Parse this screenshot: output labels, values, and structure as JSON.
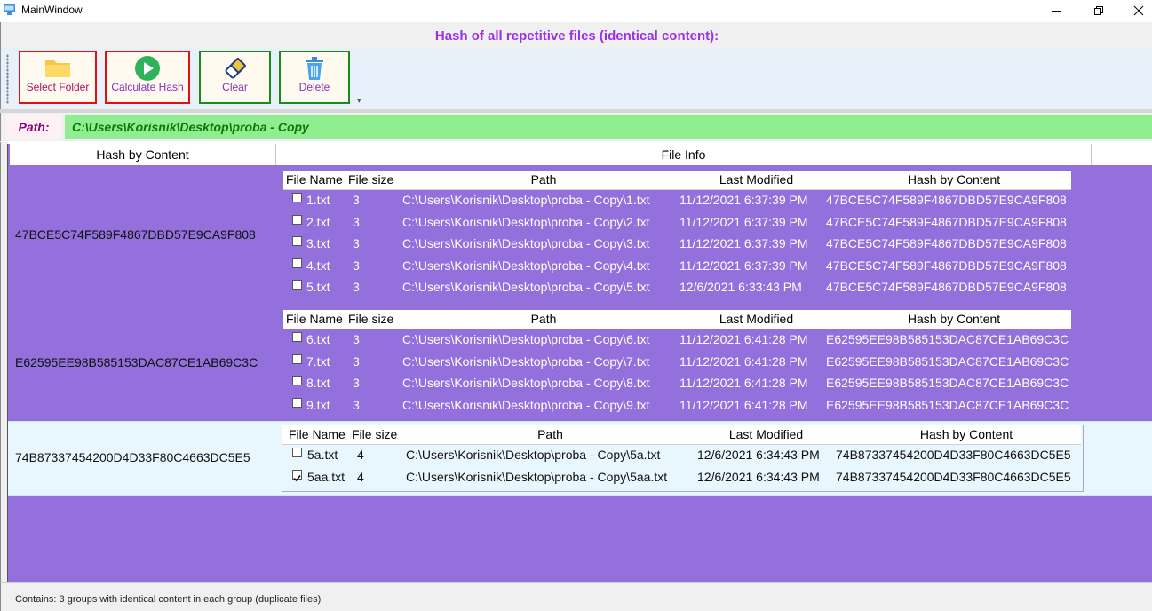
{
  "window": {
    "title": "MainWindow",
    "controls": {
      "minimize": "minimize-icon",
      "maximize": "restore-icon",
      "close": "close-icon"
    }
  },
  "header": {
    "title": "Hash of all repetitive files (identical content):",
    "color": "#9b30e8"
  },
  "toolbar": {
    "buttons": [
      {
        "label": "Select Folder",
        "icon": "folder-icon"
      },
      {
        "label": "Calculate Hash",
        "icon": "play-icon"
      },
      {
        "label": "Clear",
        "icon": "eraser-icon"
      },
      {
        "label": "Delete",
        "icon": "trash-icon"
      }
    ]
  },
  "path": {
    "label": "Path:",
    "value": "C:\\Users\\Korisnik\\Desktop\\proba - Copy"
  },
  "grid": {
    "columns": [
      "Hash by Content",
      "File Info"
    ],
    "inner_columns": [
      "File Name",
      "File size",
      "Path",
      "Last Modified",
      "Hash by Content"
    ],
    "groups": [
      {
        "hash": "47BCE5C74F589F4867DBD57E9CA9F808",
        "files": [
          {
            "name": "1.txt",
            "size": "3",
            "path": "C:\\Users\\Korisnik\\Desktop\\proba - Copy\\1.txt",
            "modified": "11/12/2021 6:37:39 PM",
            "hash": "47BCE5C74F589F4867DBD57E9CA9F808",
            "checked": false
          },
          {
            "name": "2.txt",
            "size": "3",
            "path": "C:\\Users\\Korisnik\\Desktop\\proba - Copy\\2.txt",
            "modified": "11/12/2021 6:37:39 PM",
            "hash": "47BCE5C74F589F4867DBD57E9CA9F808",
            "checked": false
          },
          {
            "name": "3.txt",
            "size": "3",
            "path": "C:\\Users\\Korisnik\\Desktop\\proba - Copy\\3.txt",
            "modified": "11/12/2021 6:37:39 PM",
            "hash": "47BCE5C74F589F4867DBD57E9CA9F808",
            "checked": false
          },
          {
            "name": "4.txt",
            "size": "3",
            "path": "C:\\Users\\Korisnik\\Desktop\\proba - Copy\\4.txt",
            "modified": "11/12/2021 6:37:39 PM",
            "hash": "47BCE5C74F589F4867DBD57E9CA9F808",
            "checked": false
          },
          {
            "name": "5.txt",
            "size": "3",
            "path": "C:\\Users\\Korisnik\\Desktop\\proba - Copy\\5.txt",
            "modified": "12/6/2021 6:33:43 PM",
            "hash": "47BCE5C74F589F4867DBD57E9CA9F808",
            "checked": false
          }
        ]
      },
      {
        "hash": "E62595EE98B585153DAC87CE1AB69C3C",
        "files": [
          {
            "name": "6.txt",
            "size": "3",
            "path": "C:\\Users\\Korisnik\\Desktop\\proba - Copy\\6.txt",
            "modified": "11/12/2021 6:41:28 PM",
            "hash": "E62595EE98B585153DAC87CE1AB69C3C",
            "checked": false
          },
          {
            "name": "7.txt",
            "size": "3",
            "path": "C:\\Users\\Korisnik\\Desktop\\proba - Copy\\7.txt",
            "modified": "11/12/2021 6:41:28 PM",
            "hash": "E62595EE98B585153DAC87CE1AB69C3C",
            "checked": false
          },
          {
            "name": "8.txt",
            "size": "3",
            "path": "C:\\Users\\Korisnik\\Desktop\\proba - Copy\\8.txt",
            "modified": "11/12/2021 6:41:28 PM",
            "hash": "E62595EE98B585153DAC87CE1AB69C3C",
            "checked": false
          },
          {
            "name": "9.txt",
            "size": "3",
            "path": "C:\\Users\\Korisnik\\Desktop\\proba - Copy\\9.txt",
            "modified": "11/12/2021 6:41:28 PM",
            "hash": "E62595EE98B585153DAC87CE1AB69C3C",
            "checked": false
          }
        ]
      },
      {
        "hash": "74B87337454200D4D33F80C4663DC5E5",
        "selected": true,
        "files": [
          {
            "name": "5a.txt",
            "size": "4",
            "path": "C:\\Users\\Korisnik\\Desktop\\proba - Copy\\5a.txt",
            "modified": "12/6/2021 6:34:43 PM",
            "hash": "74B87337454200D4D33F80C4663DC5E5",
            "checked": false
          },
          {
            "name": "5aa.txt",
            "size": "4",
            "path": "C:\\Users\\Korisnik\\Desktop\\proba - Copy\\5aa.txt",
            "modified": "12/6/2021 6:34:43 PM",
            "hash": "74B87337454200D4D33F80C4663DC5E5",
            "checked": true
          }
        ]
      }
    ]
  },
  "status": {
    "text": "Contains: 3 groups with identical content in each group (duplicate files)"
  },
  "colors": {
    "grid_bg": "#9370db",
    "path_bg": "#90ee90",
    "selected_bg": "#e8f6fd"
  }
}
